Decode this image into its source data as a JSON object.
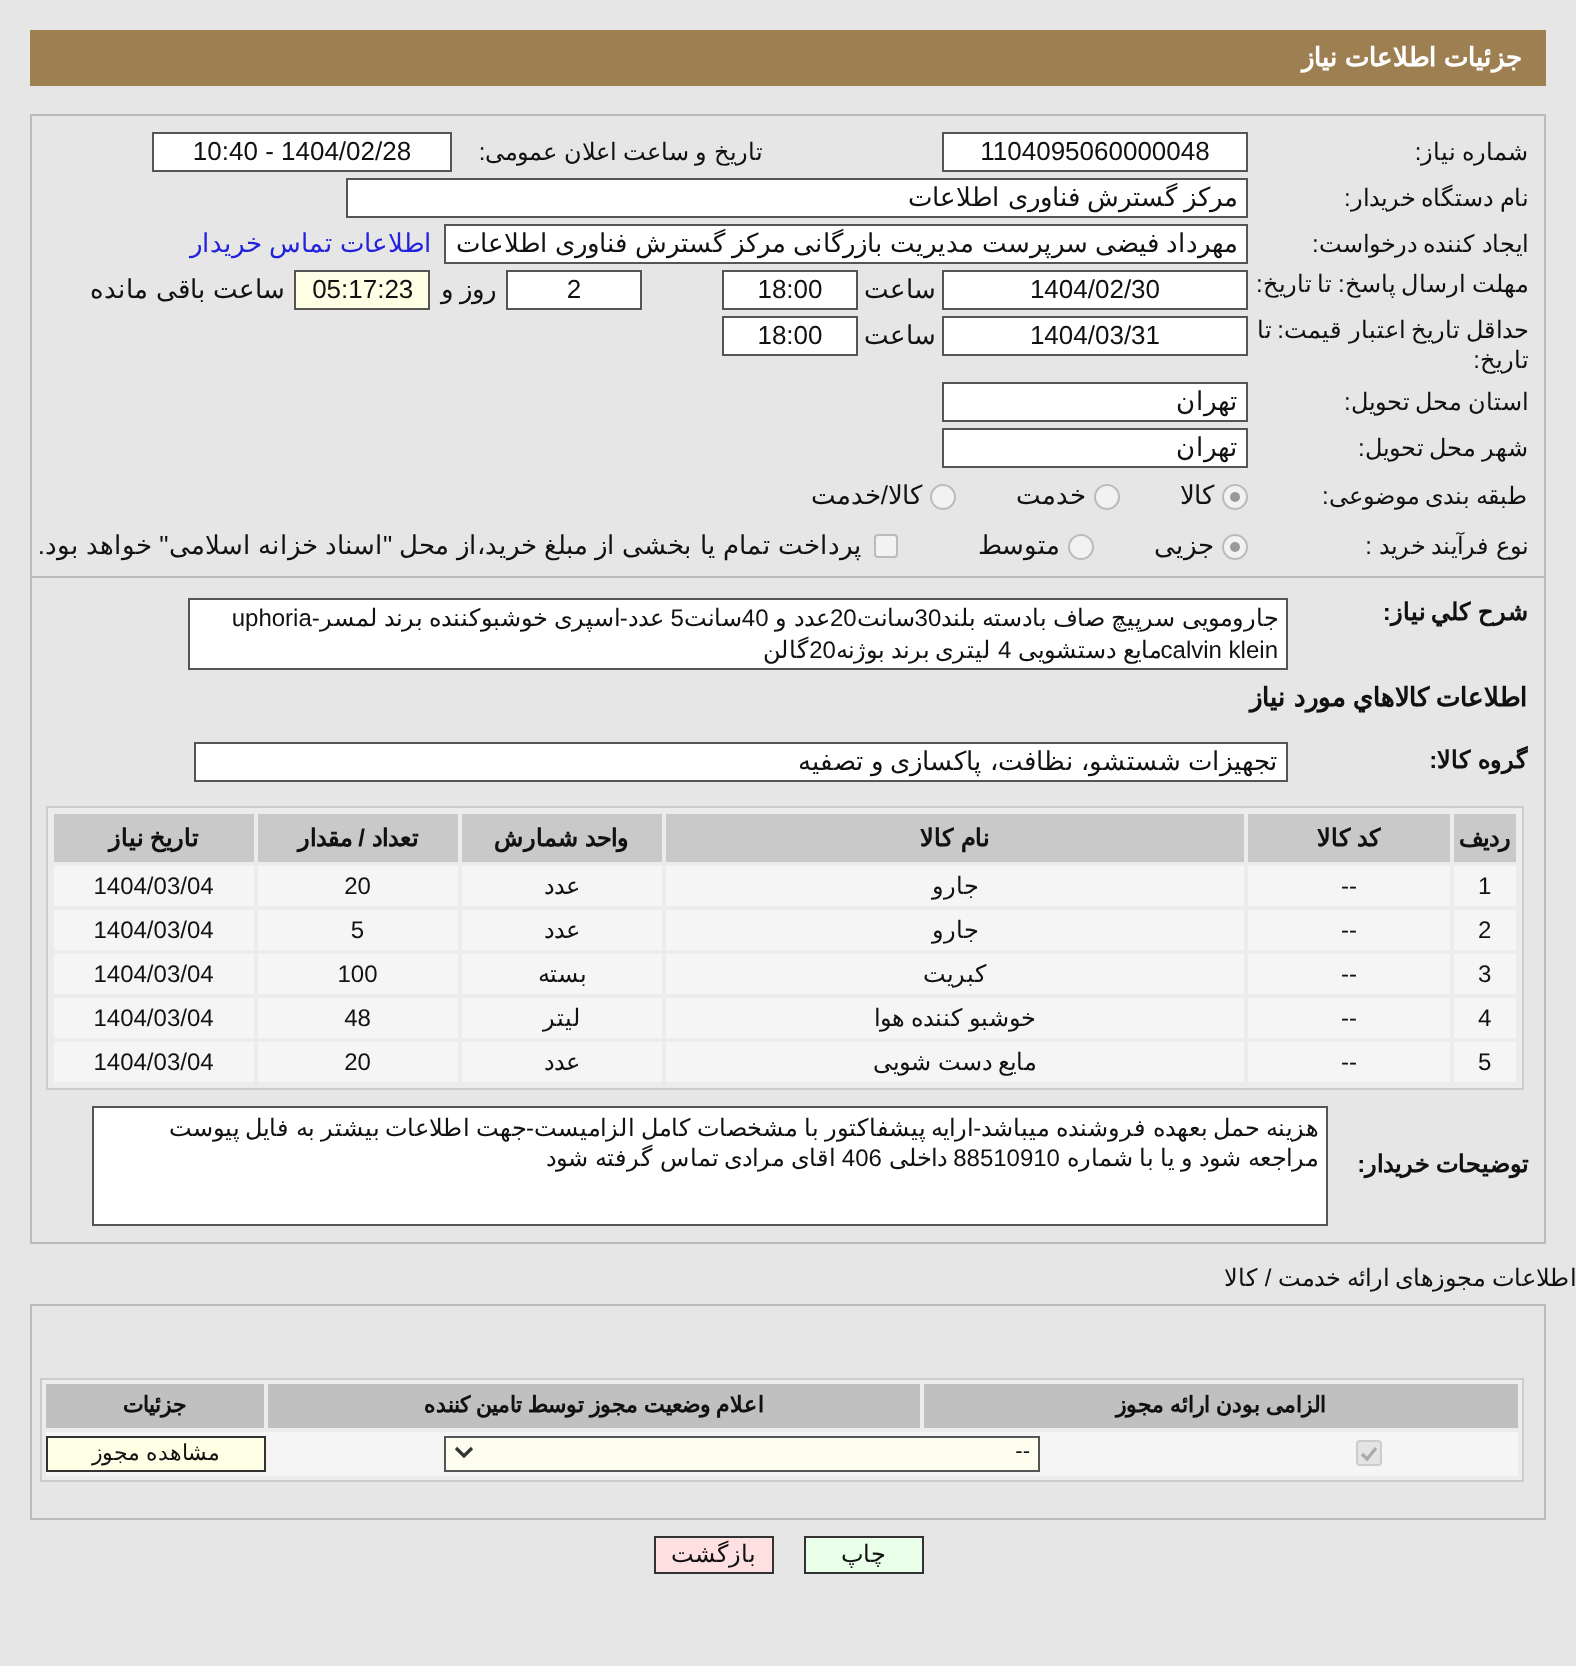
{
  "header": {
    "title": "جزئیات اطلاعات نیاز"
  },
  "need_number": {
    "label": "شماره نیاز:",
    "value": "1104095060000048"
  },
  "announce": {
    "label": "تاریخ و ساعت اعلان عمومی:",
    "value": "1404/02/28 - 10:40"
  },
  "buyer_org": {
    "label": "نام دستگاه خریدار:",
    "value": "مرکز گسترش فناوری اطلاعات"
  },
  "creator": {
    "label": "ایجاد کننده درخواست:",
    "value": "مهرداد فیضی سرپرست مدیریت بازرگانی مرکز گسترش فناوری اطلاعات",
    "link": "اطلاعات تماس خریدار"
  },
  "reply_deadline": {
    "label": "مهلت ارسال پاسخ: تا تاریخ:",
    "date": "1404/02/30",
    "time_label": "ساعت",
    "time": "18:00",
    "days": "2",
    "days_label": "روز و",
    "remaining": "05:17:23",
    "remaining_label": "ساعت باقی مانده"
  },
  "price_validity": {
    "label": "حداقل تاریخ اعتبار قیمت: تا تاریخ:",
    "date": "1404/03/31",
    "time_label": "ساعت",
    "time": "18:00"
  },
  "province": {
    "label": "استان محل تحویل:",
    "value": "تهران"
  },
  "city": {
    "label": "شهر محل تحویل:",
    "value": "تهران"
  },
  "category": {
    "label": "طبقه بندی موضوعی:",
    "options": [
      {
        "label": "کالا",
        "selected": true
      },
      {
        "label": "خدمت",
        "selected": false
      },
      {
        "label": "کالا/خدمت",
        "selected": false
      }
    ]
  },
  "process": {
    "label": "نوع فرآیند خرید :",
    "options": [
      {
        "label": "جزیی",
        "selected": true
      },
      {
        "label": "متوسط",
        "selected": false
      }
    ],
    "treasury": {
      "label": "پرداخت تمام یا بخشی از مبلغ خرید،از محل \"اسناد خزانه اسلامی\" خواهد بود.",
      "checked": false
    }
  },
  "description": {
    "label": "شرح کلي نياز:",
    "value": "جارومویی سرپیچ صاف بادسته بلند30سانت20عدد و 40سانت5 عدد-اسپری خوشبوکننده برند لمسر-uphoria calvin kleinمایع دستشویی 4 لیتری برند بوژنه20گالن"
  },
  "goods_heading": "اطلاعات کالاهاي مورد نياز",
  "goods_group": {
    "label": "گروه کالا:",
    "value": "تجهیزات شستشو، نظافت، پاکسازی و تصفیه"
  },
  "items_table": {
    "columns": [
      "ردیف",
      "کد کالا",
      "نام کالا",
      "واحد شمارش",
      "تعداد / مقدار",
      "تاریخ نیاز"
    ],
    "rows": [
      {
        "row": "1",
        "code": "--",
        "name": "جارو",
        "unit": "عدد",
        "quantity": "20",
        "date": "1404/03/04"
      },
      {
        "row": "2",
        "code": "--",
        "name": "جارو",
        "unit": "عدد",
        "quantity": "5",
        "date": "1404/03/04"
      },
      {
        "row": "3",
        "code": "--",
        "name": "کبریت",
        "unit": "بسته",
        "quantity": "100",
        "date": "1404/03/04"
      },
      {
        "row": "4",
        "code": "--",
        "name": "خوشبو کننده هوا",
        "unit": "لیتر",
        "quantity": "48",
        "date": "1404/03/04"
      },
      {
        "row": "5",
        "code": "--",
        "name": "مایع دست شویی",
        "unit": "عدد",
        "quantity": "20",
        "date": "1404/03/04"
      }
    ]
  },
  "buyer_notes": {
    "label": "توضیحات خریدار:",
    "value": "هزینه حمل بعهده فروشنده میباشد-ارایه پیشفاکتور با مشخصات کامل الزامیست-جهت اطلاعات بیشتر به فایل پیوست مراجعه شود و یا با شماره 88510910 داخلی 406 اقای مرادی تماس گرفته شود"
  },
  "permits": {
    "heading": "اطلاعات مجوزهای ارائه خدمت / کالا",
    "columns": [
      "الزامی بودن ارائه مجوز",
      "اعلام وضعیت مجوز توسط تامین کننده",
      "جزئیات"
    ],
    "rows": [
      {
        "required": true,
        "status": "--",
        "details": "مشاهده مجوز"
      }
    ]
  },
  "buttons": [
    {
      "kind": "print",
      "label": "چاپ"
    },
    {
      "kind": "back",
      "label": "بازگشت"
    }
  ]
}
